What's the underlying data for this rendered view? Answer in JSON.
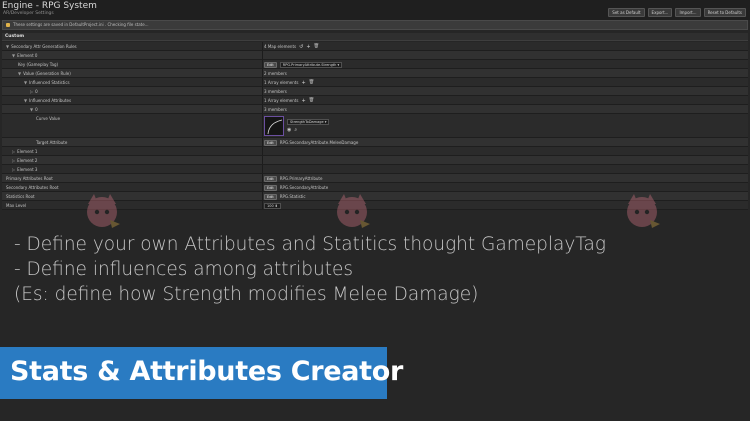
{
  "window": {
    "title": "Engine - RPG System",
    "subtitle": "AR/Developer Settings"
  },
  "toolbar": {
    "buttons": [
      "Set as Default",
      "Export...",
      "Import...",
      "Reset to Defaults"
    ]
  },
  "notice": {
    "text": "These settings are saved in DefaultProject.ini . Checking file state..."
  },
  "section": {
    "title": "Custom"
  },
  "rows": [
    {
      "label": "Secondary Attr Generation Rules",
      "indent": 0,
      "arrow": "▼",
      "value": "4 Map elements",
      "controls": [
        "reset",
        "plus",
        "trash"
      ]
    },
    {
      "label": "Element 0",
      "indent": 1,
      "arrow": "▼",
      "value": ""
    },
    {
      "label": "Key (Gameplay Tag)",
      "indent": 2,
      "arrow": "",
      "value": "RPG.PrimaryAttribute.Strength",
      "edit": "Edit",
      "combo": true
    },
    {
      "label": "Value (Generation Rule)",
      "indent": 2,
      "arrow": "▼",
      "value": "2 members"
    },
    {
      "label": "Influenced Statistics",
      "indent": 3,
      "arrow": "▼",
      "value": "1 Array elements",
      "controls": [
        "plus",
        "trash"
      ]
    },
    {
      "label": "0",
      "indent": 4,
      "arrow": "▷",
      "value": "3 members"
    },
    {
      "label": "Influenced Attributes",
      "indent": 3,
      "arrow": "▼",
      "value": "1 Array elements",
      "controls": [
        "plus",
        "trash"
      ]
    },
    {
      "label": "0",
      "indent": 4,
      "arrow": "▼",
      "value": "3 members"
    },
    {
      "label": "Curve Value",
      "indent": 5,
      "arrow": "",
      "value": "StrengthToDamage",
      "curve": true
    },
    {
      "label": "Target Attribute",
      "indent": 5,
      "arrow": "",
      "value": "RPG.SecondaryAttribute.MeleeDamage",
      "edit": "Edit"
    },
    {
      "label": "Element 1",
      "indent": 1,
      "arrow": "▷",
      "value": ""
    },
    {
      "label": "Element 2",
      "indent": 1,
      "arrow": "▷",
      "value": ""
    },
    {
      "label": "Element 3",
      "indent": 1,
      "arrow": "▷",
      "value": ""
    },
    {
      "label": "Primary Attributes Root",
      "indent": 0,
      "arrow": "",
      "value": "RPG.PrimaryAttribute",
      "edit": "Edit"
    },
    {
      "label": "Secondary Attributes Root",
      "indent": 0,
      "arrow": "",
      "value": "RPG.SecondaryAttribute",
      "edit": "Edit"
    },
    {
      "label": "Statistics Root",
      "indent": 0,
      "arrow": "",
      "value": "RPG.Statistic",
      "edit": "Edit"
    },
    {
      "label": "Max Level",
      "indent": 0,
      "arrow": "",
      "value": "100",
      "spin": true
    }
  ],
  "bullets": [
    "- Define your own Attributes and Statitics thought GameplayTag",
    "- Define influences among attributes",
    "(Es: define how Strength modifies Melee Damage)"
  ],
  "banner": {
    "text": "Stats & Attributes Creator",
    "color": "#2a7bc2"
  },
  "colors": {
    "background": "#262626",
    "accent": "#2a7bc2",
    "mascot": "#e07a8a"
  },
  "icons": {
    "plus": "+",
    "trash": "🗑",
    "reset": "↺",
    "browse": "◉",
    "search": "⌕"
  }
}
